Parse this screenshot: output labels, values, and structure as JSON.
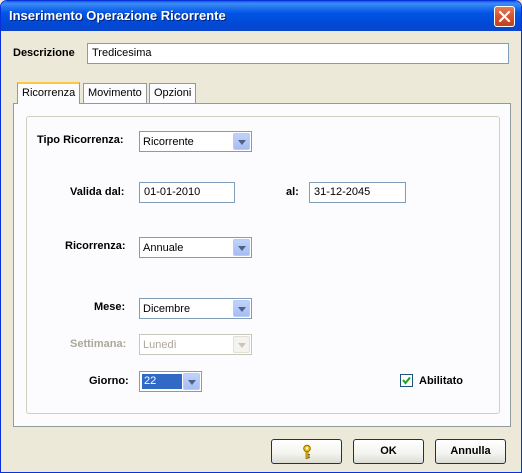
{
  "window": {
    "title": "Inserimento Operazione Ricorrente"
  },
  "description": {
    "label": "Descrizione",
    "value": "Tredicesima"
  },
  "tabs": [
    {
      "label": "Ricorrenza",
      "active": true
    },
    {
      "label": "Movimento",
      "active": false
    },
    {
      "label": "Opzioni",
      "active": false
    }
  ],
  "form": {
    "tipo_ricorrenza": {
      "label": "Tipo Ricorrenza:",
      "value": "Ricorrente"
    },
    "valida_dal": {
      "label": "Valida dal:",
      "value": "01-01-2010"
    },
    "al": {
      "label": "al:",
      "value": "31-12-2045"
    },
    "ricorrenza": {
      "label": "Ricorrenza:",
      "value": "Annuale"
    },
    "mese": {
      "label": "Mese:",
      "value": "Dicembre"
    },
    "settimana": {
      "label": "Settimana:",
      "value": "Lunedì",
      "disabled": true
    },
    "giorno": {
      "label": "Giorno:",
      "value": "22"
    },
    "abilitato": {
      "label": "Abilitato",
      "checked": true
    }
  },
  "buttons": {
    "help_icon": "key-icon",
    "ok": "OK",
    "annulla": "Annulla"
  },
  "colors": {
    "titlebar": "#0055e5",
    "dialog_bg": "#ece9d8",
    "selection": "#316ac5"
  }
}
